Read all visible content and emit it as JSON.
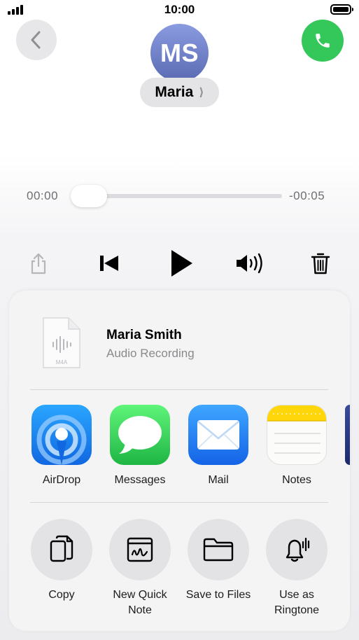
{
  "status_bar": {
    "time": "10:00"
  },
  "header": {
    "avatar_initials": "MS",
    "contact_name": "Maria",
    "call_color": "#34c759",
    "back_icon": "chevron-left-icon",
    "call_icon": "phone-icon"
  },
  "player": {
    "elapsed": "00:00",
    "remaining": "-00:05",
    "progress": 0.0,
    "controls": [
      "share-icon",
      "skip-back-icon",
      "play-icon",
      "speaker-icon",
      "trash-icon"
    ]
  },
  "share_sheet": {
    "file": {
      "title": "Maria Smith",
      "subtitle": "Audio Recording",
      "type": "M4A"
    },
    "apps": [
      {
        "label": "AirDrop",
        "icon": "airdrop-icon",
        "color": "#1e8cf0"
      },
      {
        "label": "Messages",
        "icon": "messages-icon",
        "color": "#34c759"
      },
      {
        "label": "Mail",
        "icon": "mail-icon",
        "color": "#1a82f7"
      },
      {
        "label": "Notes",
        "icon": "notes-icon",
        "color": "#ffd60a"
      }
    ],
    "actions": [
      {
        "label": "Copy",
        "icon": "copy-icon"
      },
      {
        "label": "New Quick\nNote",
        "icon": "quick-note-icon"
      },
      {
        "label": "Save to Files",
        "icon": "folder-icon"
      },
      {
        "label": "Use as\nRingtone",
        "icon": "bell-icon"
      }
    ]
  }
}
